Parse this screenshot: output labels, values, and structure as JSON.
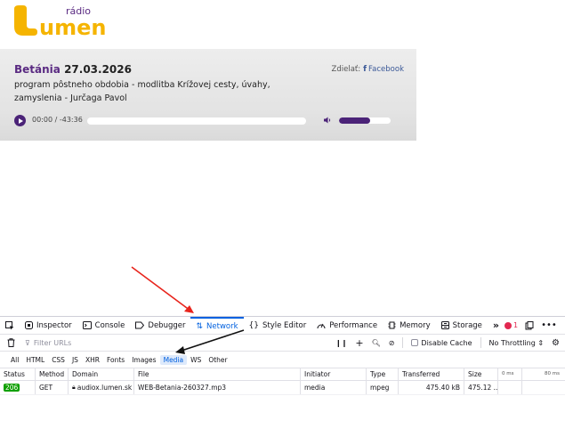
{
  "logo": {
    "small": "rádio",
    "big": "umen"
  },
  "card": {
    "title_name": "Betánia",
    "title_date": "27.03.2026",
    "description": "program pôstneho obdobia - modlitba Krížovej cesty, úvahy, zamyslenia - Jurčaga Pavol",
    "share_label": "Zdielať:",
    "share_fb": "Facebook",
    "time": "00:00 / -43:36",
    "volume_level": 0.6
  },
  "devtools": {
    "tabs": [
      {
        "label": "Inspector",
        "icon": "inspector-icon"
      },
      {
        "label": "Console",
        "icon": "console-icon"
      },
      {
        "label": "Debugger",
        "icon": "debugger-icon"
      },
      {
        "label": "Network",
        "icon": "network-icon"
      },
      {
        "label": "Style Editor",
        "icon": "style-editor-icon"
      },
      {
        "label": "Performance",
        "icon": "performance-icon"
      },
      {
        "label": "Memory",
        "icon": "memory-icon"
      },
      {
        "label": "Storage",
        "icon": "storage-icon"
      }
    ],
    "more_tabs": "»",
    "error_count": "1",
    "filter_placeholder": "Filter URLs",
    "disable_cache": "Disable Cache",
    "throttling": "No Throttling ⇕",
    "type_filters": [
      "All",
      "HTML",
      "CSS",
      "JS",
      "XHR",
      "Fonts",
      "Images",
      "Media",
      "WS",
      "Other"
    ],
    "columns": {
      "status": "Status",
      "method": "Method",
      "domain": "Domain",
      "file": "File",
      "initiator": "Initiator",
      "type": "Type",
      "transferred": "Transferred",
      "size": "Size",
      "wf0": "0 ms",
      "wf1": "80 ms"
    },
    "rows": [
      {
        "status": "206",
        "method": "GET",
        "domain": "audiox.lumen.sk",
        "file": "WEB-Betania-260327.mp3",
        "initiator": "media",
        "type": "mpeg",
        "transferred": "475.40 kB",
        "size": "475.12 ..."
      }
    ]
  },
  "colors": {
    "brand_yellow": "#f5b400",
    "brand_purple": "#5a2a82",
    "network_blue": "#0060df",
    "status_green": "#10a000"
  }
}
